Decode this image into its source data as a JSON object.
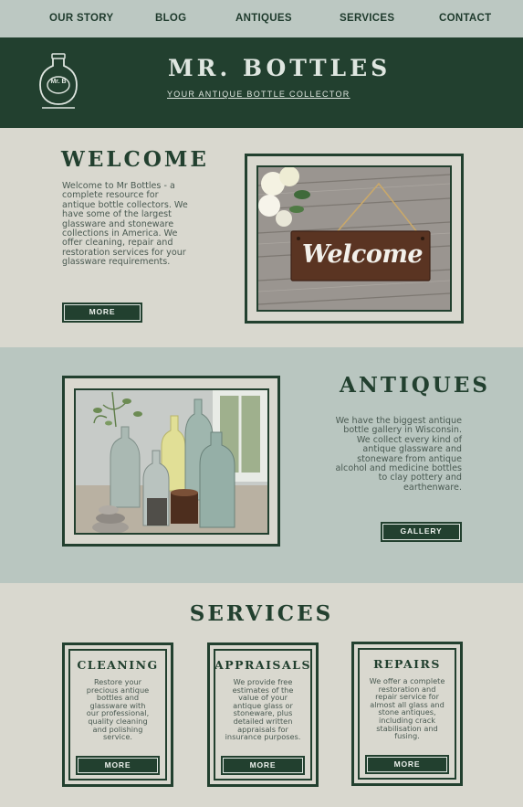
{
  "nav": {
    "items": [
      "OUR STORY",
      "BLOG",
      "ANTIQUES",
      "SERVICES",
      "CONTACT"
    ]
  },
  "header": {
    "logo_text": "Mr. B",
    "title": "MR. BOTTLES",
    "tagline": "YOUR ANTIQUE BOTTLE COLLECTOR"
  },
  "welcome": {
    "heading": "WELCOME",
    "lines": [
      "Welcome to Mr Bottles - a",
      "complete resource for",
      "antique bottle collectors. We",
      "have some of the largest",
      "glassware and stoneware",
      "collections in America. We",
      "offer cleaning, repair and",
      "restoration services for your",
      "glassware requirements."
    ],
    "button": "MORE",
    "sign_text": "Welcome"
  },
  "antiques": {
    "heading": "ANTIQUES",
    "lines": [
      "We have the biggest antique",
      "bottle gallery in Wisconsin.",
      "We collect every kind of",
      "antique glassware and",
      "stoneware from antique",
      "alcohol and medicine bottles",
      "to clay pottery and",
      "earthenware."
    ],
    "button": "GALLERY"
  },
  "services": {
    "heading": "SERVICES",
    "cards": [
      {
        "title": "CLEANING",
        "lines": [
          "Restore your",
          "precious antique",
          "bottles and",
          "glassware with",
          "our professional,",
          "quality cleaning",
          "and polishing",
          "service."
        ],
        "button": "MORE"
      },
      {
        "title": "APPRAISALS",
        "lines": [
          "We provide free",
          "estimates of the",
          "value of your",
          "antique glass or",
          "stoneware, plus",
          "detailed written",
          "appraisals for",
          "insurance purposes."
        ],
        "button": "MORE"
      },
      {
        "title": "REPAIRS",
        "lines": [
          "We offer a complete",
          "restoration and",
          "repair service for",
          "almost all glass and",
          "stone antiques,",
          "including crack",
          "stabilisation and",
          "fusing."
        ],
        "button": "MORE"
      }
    ]
  },
  "colors": {
    "dark_green": "#22402f",
    "nav_bg": "#bcc8c2",
    "page_bg": "#d9d8cf",
    "antiques_bg": "#b9c6c0"
  }
}
